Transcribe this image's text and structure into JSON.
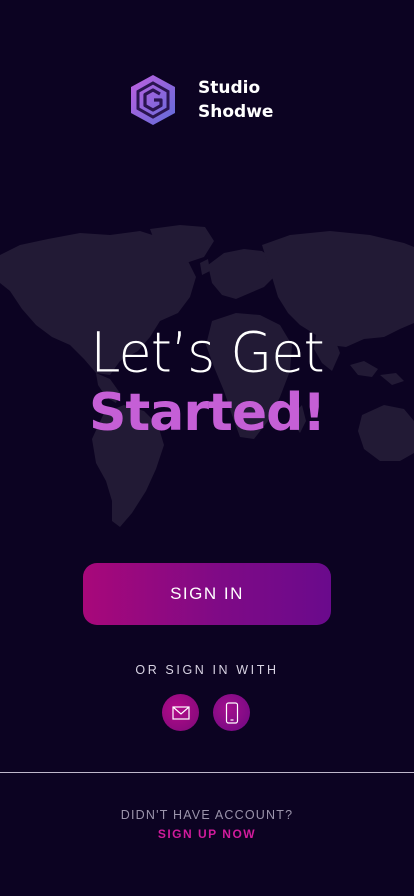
{
  "brand": {
    "name_line1": "Studio",
    "name_line2": "Shodwe",
    "logo_icon": "hexagon-g-logo"
  },
  "hero": {
    "line1": "Let’s Get",
    "line2": "Started!"
  },
  "actions": {
    "signin_label": "SIGN IN",
    "or_label": "OR SIGN IN WITH",
    "social": [
      {
        "icon": "mail-icon"
      },
      {
        "icon": "phone-icon"
      }
    ]
  },
  "footer": {
    "prompt": "DIDN'T HAVE ACCOUNT?",
    "signup_label": "SIGN UP NOW"
  },
  "colors": {
    "background": "#0c0322",
    "accent_purple": "#c55fd6",
    "accent_magenta": "#d11b9c",
    "button_start": "#a8087a",
    "button_end": "#6a0a8c",
    "map": "#221a35"
  }
}
